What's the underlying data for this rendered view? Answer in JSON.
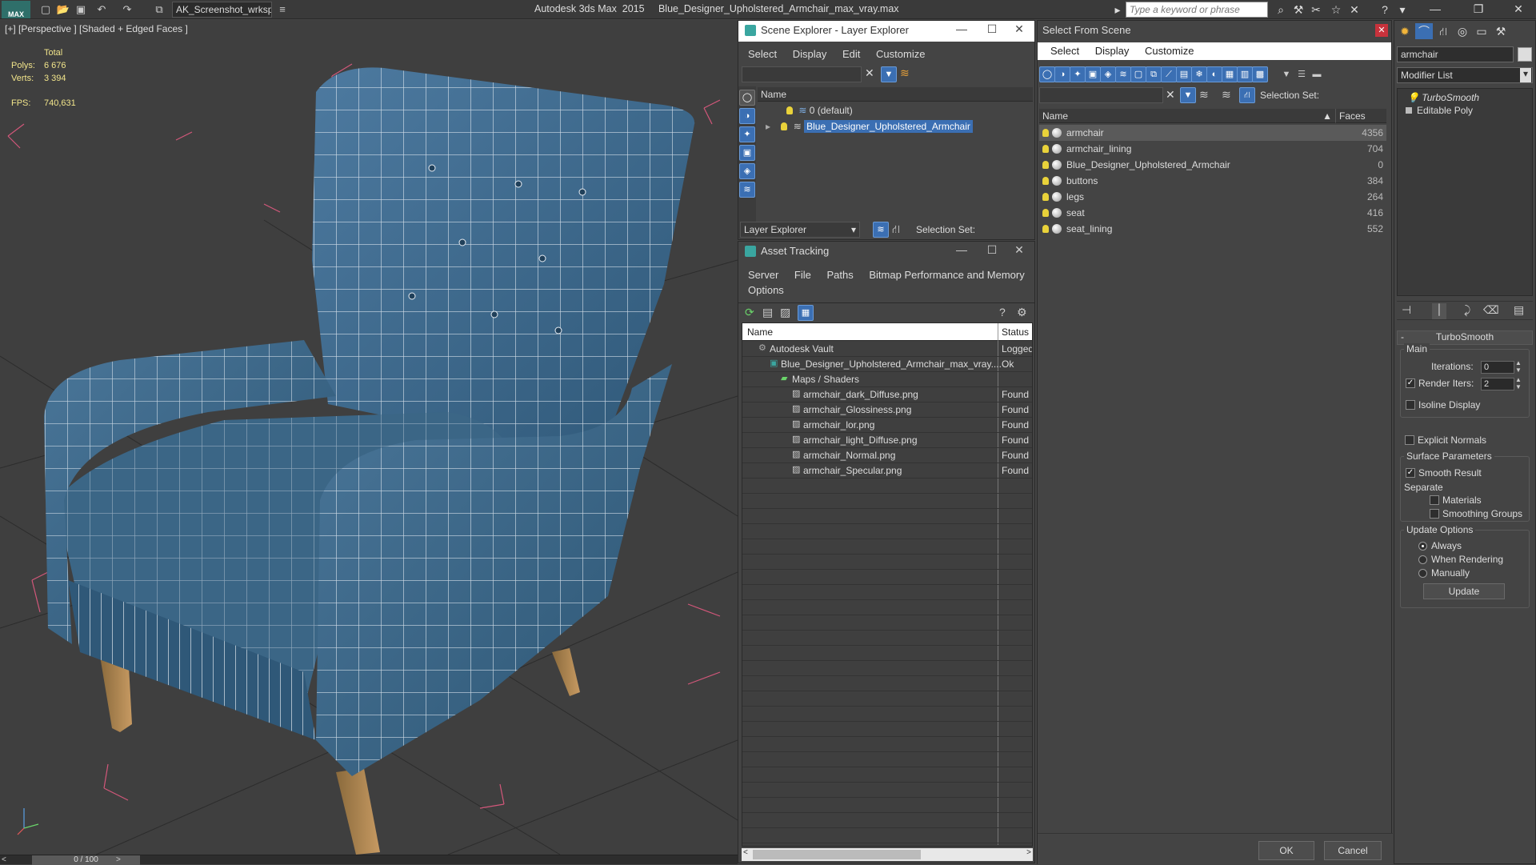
{
  "titlebar": {
    "workspace": "AK_Screenshot_wrksp",
    "app_title": "Autodesk 3ds Max  2015     Blue_Designer_Upholstered_Armchair_max_vray.max",
    "search_placeholder": "Type a keyword or phrase",
    "logo": "MAX"
  },
  "viewport": {
    "label": "[+] [Perspective ] [Shaded + Edged Faces ]",
    "stats": {
      "total_label": "Total",
      "polys_label": "Polys:",
      "polys_value": "6 676",
      "verts_label": "Verts:",
      "verts_value": "3 394",
      "fps_label": "FPS:",
      "fps_value": "740,631"
    },
    "timeline": "0 / 100"
  },
  "scene_explorer": {
    "title": "Scene Explorer - Layer Explorer",
    "menu": [
      "Select",
      "Display",
      "Edit",
      "Customize"
    ],
    "column_name": "Name",
    "rows": [
      "0 (default)",
      "Blue_Designer_Upholstered_Armchair"
    ],
    "footer_dropdown": "Layer Explorer",
    "selection_set_label": "Selection Set:"
  },
  "asset_tracking": {
    "title": "Asset Tracking",
    "menu": [
      "Server",
      "File",
      "Paths",
      "Bitmap Performance and Memory"
    ],
    "menu2": "Options",
    "col_name": "Name",
    "col_status": "Status",
    "rows": [
      {
        "name": "Autodesk Vault",
        "status": "Logged",
        "indent": 0
      },
      {
        "name": "Blue_Designer_Upholstered_Armchair_max_vray....",
        "status": "Ok",
        "indent": 1
      },
      {
        "name": "Maps / Shaders",
        "status": "",
        "indent": 2
      },
      {
        "name": "armchair_dark_Diffuse.png",
        "status": "Found",
        "indent": 3
      },
      {
        "name": "armchair_Glossiness.png",
        "status": "Found",
        "indent": 3
      },
      {
        "name": "armchair_lor.png",
        "status": "Found",
        "indent": 3
      },
      {
        "name": "armchair_light_Diffuse.png",
        "status": "Found",
        "indent": 3
      },
      {
        "name": "armchair_Normal.png",
        "status": "Found",
        "indent": 3
      },
      {
        "name": "armchair_Specular.png",
        "status": "Found",
        "indent": 3
      }
    ]
  },
  "select_from_scene": {
    "title": "Select From Scene",
    "menu": [
      "Select",
      "Display",
      "Customize"
    ],
    "selection_set_label": "Selection Set:",
    "col_name": "Name",
    "col_faces": "Faces",
    "rows": [
      {
        "name": "armchair",
        "faces": "4356"
      },
      {
        "name": "armchair_lining",
        "faces": "704"
      },
      {
        "name": "Blue_Designer_Upholstered_Armchair",
        "faces": "0"
      },
      {
        "name": "buttons",
        "faces": "384"
      },
      {
        "name": "legs",
        "faces": "264"
      },
      {
        "name": "seat",
        "faces": "416"
      },
      {
        "name": "seat_lining",
        "faces": "552"
      }
    ],
    "ok": "OK",
    "cancel": "Cancel"
  },
  "command_panel": {
    "object_name": "armchair",
    "modifier_list": "Modifier List",
    "stack": [
      "TurboSmooth",
      "Editable Poly"
    ],
    "rollout_title": "TurboSmooth",
    "main_label": "Main",
    "iterations_label": "Iterations:",
    "iterations_value": "0",
    "render_iters_label": "Render Iters:",
    "render_iters_value": "2",
    "isoline_label": "Isoline Display",
    "explicit_label": "Explicit Normals",
    "surface_label": "Surface Parameters",
    "smooth_label": "Smooth Result",
    "separate_label": "Separate",
    "materials_label": "Materials",
    "smoothing_label": "Smoothing Groups",
    "update_options_label": "Update Options",
    "always_label": "Always",
    "when_rendering_label": "When Rendering",
    "manually_label": "Manually",
    "update_button": "Update"
  },
  "colors": {
    "selection_blue": "#3b6fb3",
    "chair_blue": "#3f6a8c",
    "stat_yellow": "#f2e58b",
    "grid_red": "#d2577a"
  }
}
